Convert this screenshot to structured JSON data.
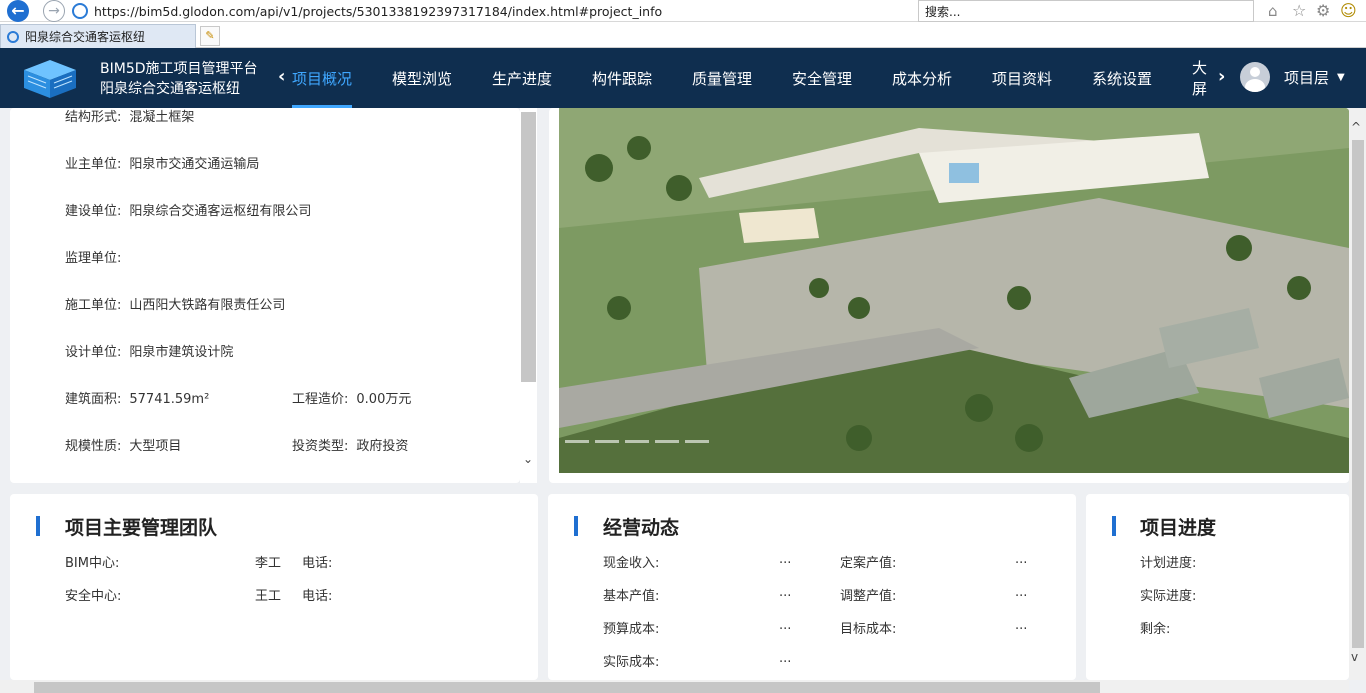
{
  "browser": {
    "url": "https://bim5d.glodon.com/api/v1/projects/53013381923973171​84/index.html#project_info",
    "search_placeholder": "搜索...",
    "tab_title": "阳泉综合交通客运枢纽"
  },
  "header": {
    "platform_name": "BIM5D施工项目管理平台",
    "project_name": "阳泉综合交通客运枢纽",
    "menu": [
      {
        "label": "项目概况",
        "active": true
      },
      {
        "label": "模型浏览"
      },
      {
        "label": "生产进度"
      },
      {
        "label": "构件跟踪"
      },
      {
        "label": "质量管理"
      },
      {
        "label": "安全管理"
      },
      {
        "label": "成本分析"
      },
      {
        "label": "项目资料"
      },
      {
        "label": "系统设置"
      },
      {
        "label": "大屏"
      }
    ],
    "user_label": "项目层"
  },
  "info": {
    "structure": {
      "label": "结构形式:",
      "value": "混凝土框架"
    },
    "owner": {
      "label": "业主单位:",
      "value": "阳泉市交通交通运输局"
    },
    "builder": {
      "label": "建设单位:",
      "value": "阳泉综合交通客运枢纽有限公司"
    },
    "supervisor": {
      "label": "监理单位:",
      "value": ""
    },
    "contractor": {
      "label": "施工单位:",
      "value": "山西阳大铁路有限责任公司"
    },
    "designer": {
      "label": "设计单位:",
      "value": "阳泉市建筑设计院"
    },
    "area": {
      "label": "建筑面积:",
      "value": "57741.59m²"
    },
    "cost": {
      "label": "工程造价:",
      "value": "0.00万元"
    },
    "scale": {
      "label": "规模性质:",
      "value": "大型项目"
    },
    "investment": {
      "label": "投资类型:",
      "value": "政府投资"
    }
  },
  "team": {
    "title": "项目主要管理团队",
    "rows": [
      {
        "dept": "BIM中心:",
        "person": "李工",
        "phone_label": "电话:"
      },
      {
        "dept": "安全中心:",
        "person": "王工",
        "phone_label": "电话:"
      }
    ]
  },
  "business": {
    "title": "经营动态",
    "items": [
      {
        "label": "现金收入:",
        "value": "..."
      },
      {
        "label": "定案产值:",
        "value": "..."
      },
      {
        "label": "基本产值:",
        "value": "..."
      },
      {
        "label": "调整产值:",
        "value": "..."
      },
      {
        "label": "预算成本:",
        "value": "..."
      },
      {
        "label": "目标成本:",
        "value": "..."
      },
      {
        "label": "实际成本:",
        "value": "..."
      }
    ]
  },
  "progress": {
    "title": "项目进度",
    "plan": "计划进度:",
    "actual": "实际进度:",
    "remaining": "剩余:"
  }
}
